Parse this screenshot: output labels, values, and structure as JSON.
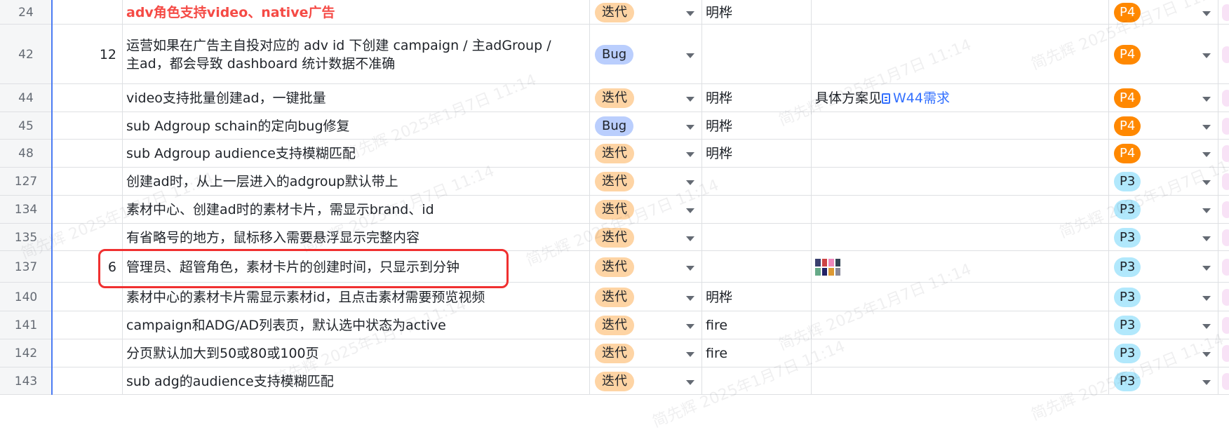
{
  "rows": [
    {
      "num": "24",
      "order": "",
      "title": "adv角色支持video、native广告",
      "title_red": true,
      "type": "迭代",
      "type_kind": "iter",
      "owner": "明桦",
      "note": "",
      "note_link": "",
      "note_image": false,
      "priority": "P4",
      "prio_kind": "p4"
    },
    {
      "num": "42",
      "order": "12",
      "title": "运营如果在广告主自投对应的 adv id 下创建 campaign / 主adGroup / 主ad，都会导致 dashboard 统计数据不准确",
      "title_red": false,
      "type": "Bug",
      "type_kind": "bug",
      "owner": "",
      "note": "",
      "note_link": "",
      "note_image": false,
      "priority": "P4",
      "prio_kind": "p4"
    },
    {
      "num": "44",
      "order": "",
      "title": "video支持批量创建ad，一键批量",
      "title_red": false,
      "type": "迭代",
      "type_kind": "iter",
      "owner": "明桦",
      "note": "具体方案见",
      "note_link": "W44需求",
      "note_image": false,
      "priority": "P4",
      "prio_kind": "p4"
    },
    {
      "num": "45",
      "order": "",
      "title": "sub Adgroup schain的定向bug修复",
      "title_red": false,
      "type": "Bug",
      "type_kind": "bug",
      "owner": "明桦",
      "note": "",
      "note_link": "",
      "note_image": false,
      "priority": "P4",
      "prio_kind": "p4"
    },
    {
      "num": "48",
      "order": "",
      "title": "sub Adgroup audience支持模糊匹配",
      "title_red": false,
      "type": "迭代",
      "type_kind": "iter",
      "owner": "明桦",
      "note": "",
      "note_link": "",
      "note_image": false,
      "priority": "P4",
      "prio_kind": "p4"
    },
    {
      "num": "127",
      "order": "",
      "title": "创建ad时，从上一层进入的adgroup默认带上",
      "title_red": false,
      "type": "迭代",
      "type_kind": "iter",
      "owner": "",
      "note": "",
      "note_link": "",
      "note_image": false,
      "priority": "P3",
      "prio_kind": "p3"
    },
    {
      "num": "134",
      "order": "",
      "title": "素材中心、创建ad时的素材卡片，需显示brand、id",
      "title_red": false,
      "type": "迭代",
      "type_kind": "iter",
      "owner": "",
      "note": "",
      "note_link": "",
      "note_image": false,
      "priority": "P3",
      "prio_kind": "p3"
    },
    {
      "num": "135",
      "order": "",
      "title": "有省略号的地方，鼠标移入需要悬浮显示完整内容",
      "title_red": false,
      "type": "迭代",
      "type_kind": "iter",
      "owner": "",
      "note": "",
      "note_link": "",
      "note_image": false,
      "priority": "P3",
      "prio_kind": "p3"
    },
    {
      "num": "137",
      "order": "6",
      "title": "管理员、超管角色，素材卡片的创建时间，只显示到分钟",
      "title_red": false,
      "type": "迭代",
      "type_kind": "iter",
      "owner": "",
      "note": "",
      "note_link": "",
      "note_image": true,
      "priority": "P3",
      "prio_kind": "p3"
    },
    {
      "num": "140",
      "order": "",
      "title": "素材中心的素材卡片需显示素材id，且点击素材需要预览视频",
      "title_red": false,
      "type": "迭代",
      "type_kind": "iter",
      "owner": "明桦",
      "note": "",
      "note_link": "",
      "note_image": false,
      "priority": "P3",
      "prio_kind": "p3"
    },
    {
      "num": "141",
      "order": "",
      "title": "campaign和ADG/AD列表页，默认选中状态为active",
      "title_red": false,
      "type": "迭代",
      "type_kind": "iter",
      "owner": "fire",
      "note": "",
      "note_link": "",
      "note_image": false,
      "priority": "P3",
      "prio_kind": "p3"
    },
    {
      "num": "142",
      "order": "",
      "title": "分页默认加大到50或80或100页",
      "title_red": false,
      "type": "迭代",
      "type_kind": "iter",
      "owner": "fire",
      "note": "",
      "note_link": "",
      "note_image": false,
      "priority": "P3",
      "prio_kind": "p3"
    },
    {
      "num": "143",
      "order": "",
      "title": "sub adg的audience支持模糊匹配",
      "title_red": false,
      "type": "迭代",
      "type_kind": "iter",
      "owner": "",
      "note": "",
      "note_link": "",
      "note_image": false,
      "priority": "P3",
      "prio_kind": "p3"
    }
  ],
  "watermark": "简先辉 2025年1月7日 11:14",
  "colors": {
    "iter": "#fed4a4",
    "bug": "#bacefd",
    "p4": "#ff8800",
    "p3": "#b1e8fc",
    "highlight": "#f03030",
    "title_red": "#f54a45",
    "link": "#3370ff"
  },
  "icons": {
    "dropdown": "chevron-down-icon",
    "doc": "doc-icon",
    "image": "image-thumbnail"
  }
}
